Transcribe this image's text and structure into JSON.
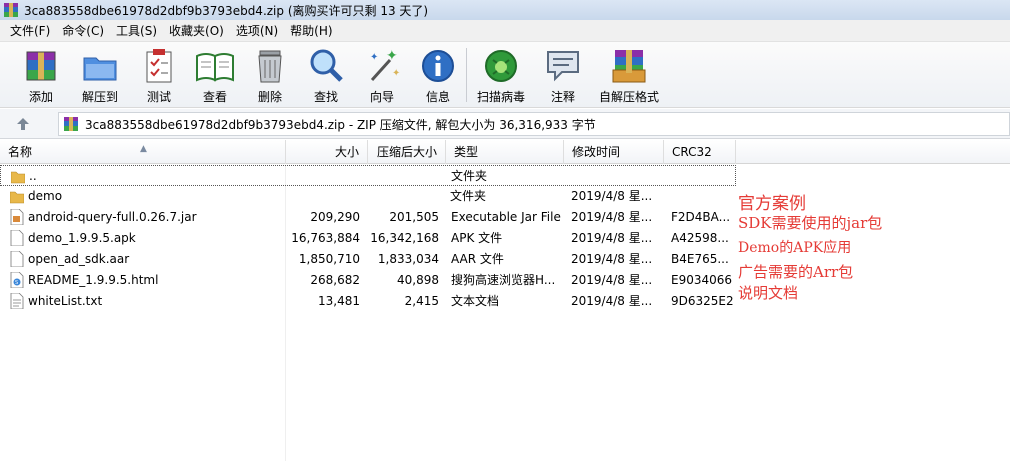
{
  "window": {
    "title": "3ca883558dbe61978d2dbf9b3793ebd4.zip (离购买许可只剩 13 天了)"
  },
  "menu": [
    {
      "label": "文件(F)"
    },
    {
      "label": "命令(C)"
    },
    {
      "label": "工具(S)"
    },
    {
      "label": "收藏夹(O)"
    },
    {
      "label": "选项(N)"
    },
    {
      "label": "帮助(H)"
    }
  ],
  "toolbar": {
    "buttons": [
      {
        "label": "添加",
        "icon": "add-archive-icon"
      },
      {
        "label": "解压到",
        "icon": "extract-to-icon"
      },
      {
        "label": "测试",
        "icon": "test-icon"
      },
      {
        "label": "查看",
        "icon": "view-book-icon"
      },
      {
        "label": "删除",
        "icon": "trash-icon"
      },
      {
        "label": "查找",
        "icon": "find-magnifier-icon"
      },
      {
        "label": "向导",
        "icon": "wizard-wand-icon"
      },
      {
        "label": "信息",
        "icon": "info-icon"
      },
      {
        "label": "扫描病毒",
        "icon": "virus-scan-icon"
      },
      {
        "label": "注释",
        "icon": "comment-icon"
      },
      {
        "label": "自解压格式",
        "icon": "sfx-icon"
      }
    ]
  },
  "address": {
    "path": "3ca883558dbe61978d2dbf9b3793ebd4.zip - ZIP 压缩文件, 解包大小为 36,316,933 字节"
  },
  "columns": {
    "name": "名称",
    "size": "大小",
    "packed": "压缩后大小",
    "type": "类型",
    "modified": "修改时间",
    "crc": "CRC32"
  },
  "files": [
    {
      "name": "..",
      "size": "",
      "packed": "",
      "type": "文件夹",
      "modified": "",
      "crc": "",
      "icon": "folder-up-icon"
    },
    {
      "name": "demo",
      "size": "",
      "packed": "",
      "type": "文件夹",
      "modified": "2019/4/8 星...",
      "crc": "",
      "icon": "folder-icon"
    },
    {
      "name": "android-query-full.0.26.7.jar",
      "size": "209,290",
      "packed": "201,505",
      "type": "Executable Jar File",
      "modified": "2019/4/8 星...",
      "crc": "F2D4BA...",
      "icon": "jar-file-icon"
    },
    {
      "name": "demo_1.9.9.5.apk",
      "size": "16,763,884",
      "packed": "16,342,168",
      "type": "APK 文件",
      "modified": "2019/4/8 星...",
      "crc": "A42598...",
      "icon": "file-icon"
    },
    {
      "name": "open_ad_sdk.aar",
      "size": "1,850,710",
      "packed": "1,833,034",
      "type": "AAR 文件",
      "modified": "2019/4/8 星...",
      "crc": "B4E765...",
      "icon": "file-icon"
    },
    {
      "name": "README_1.9.9.5.html",
      "size": "268,682",
      "packed": "40,898",
      "type": "搜狗高速浏览器H...",
      "modified": "2019/4/8 星...",
      "crc": "E9034066",
      "icon": "html-file-icon"
    },
    {
      "name": "whiteList.txt",
      "size": "13,481",
      "packed": "2,415",
      "type": "文本文档",
      "modified": "2019/4/8 星...",
      "crc": "9D6325E2",
      "icon": "text-file-icon"
    }
  ],
  "annotations": [
    "官方案例",
    "SDK需要使用的jar包",
    "Demo的APK应用",
    "广告需要的Arr包",
    "说明文档"
  ],
  "colors": {
    "annotation": "#e53b36",
    "folder": "#e8b84a"
  }
}
